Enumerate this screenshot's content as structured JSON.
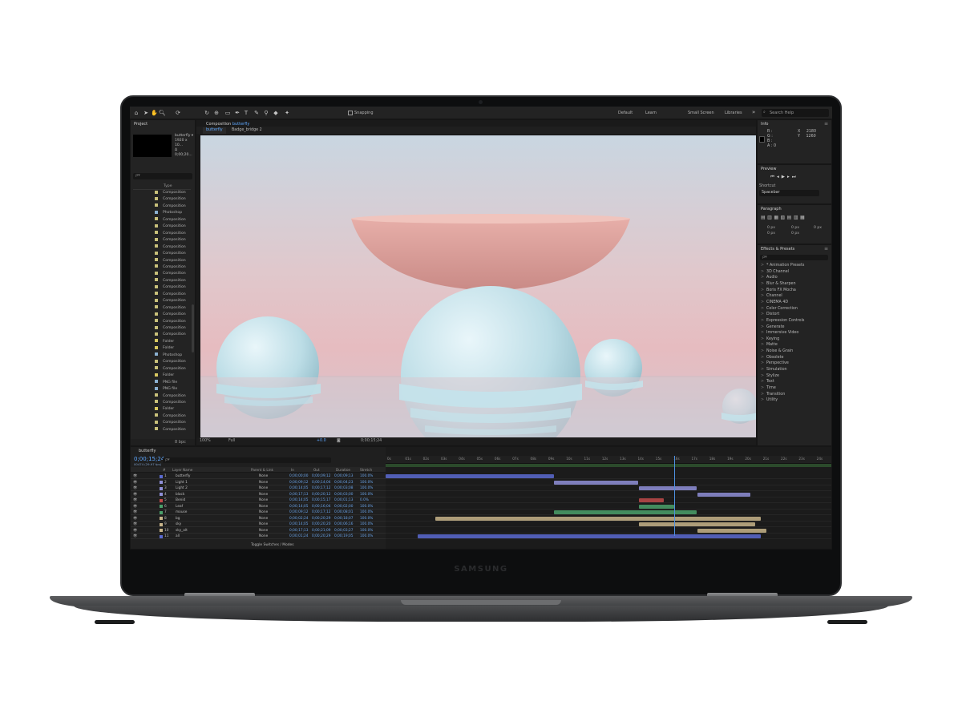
{
  "device": {
    "brand": "SAMSUNG"
  },
  "toolbar": {
    "snapping_label": "Snapping",
    "workspaces": [
      "Default",
      "Learn",
      "Small Screen",
      "Libraries"
    ],
    "search_placeholder": "Search Help",
    "more": "»"
  },
  "project_panel": {
    "title": "Project",
    "comp_name": "butterfly ▾",
    "comp_info_1": "1920 x 10...",
    "comp_info_2": "Δ 0;00;20...",
    "search_placeholder": "ρ▾",
    "column_type": "Type",
    "items": [
      "Composition",
      "Composition",
      "Composition",
      "Photoshop",
      "Composition",
      "Composition",
      "Composition",
      "Composition",
      "Composition",
      "Composition",
      "Composition",
      "Composition",
      "Composition",
      "Composition",
      "Composition",
      "Composition",
      "Composition",
      "Composition",
      "Composition",
      "Composition",
      "Composition",
      "Composition",
      "Folder",
      "Folder",
      "Photoshop",
      "Composition",
      "Composition",
      "Folder",
      "PNG file",
      "PNG file",
      "Composition",
      "Composition",
      "Folder",
      "Composition",
      "Composition",
      "Composition"
    ],
    "footer_bpc": "8 bpc"
  },
  "composition_panel": {
    "title": "Composition",
    "comp_name": "butterfly",
    "tabs": [
      "butterfly",
      "Badge_bridge 2"
    ],
    "zoom": "100%",
    "resolution": "Full",
    "exposure": "+0.0",
    "timecode": "0;00;15;24"
  },
  "info_panel": {
    "title": "Info",
    "x_label": "X",
    "x_value": "2180",
    "y_label": "Y",
    "y_value": "1260",
    "r": "R :",
    "g": "G :",
    "b": "B :",
    "a": "A : 0"
  },
  "preview_panel": {
    "title": "Preview",
    "shortcut_label": "Shortcut",
    "shortcut_value": "Spacebar"
  },
  "paragraph_panel": {
    "title": "Paragraph",
    "fields": [
      "0 px",
      "0 px",
      "0 px",
      "0 px",
      "0 px"
    ]
  },
  "effects_panel": {
    "title": "Effects & Presets",
    "search_placeholder": "ρ▾",
    "categories": [
      "* Animation Presets",
      "3D Channel",
      "Audio",
      "Blur & Sharpen",
      "Boris FX Mocha",
      "Channel",
      "CINEMA 4D",
      "Color Correction",
      "Distort",
      "Expression Controls",
      "Generate",
      "Immersive Video",
      "Keying",
      "Matte",
      "Noise & Grain",
      "Obsolete",
      "Perspective",
      "Simulation",
      "Stylize",
      "Text",
      "Time",
      "Transition",
      "Utility"
    ]
  },
  "timeline": {
    "tab": "butterfly",
    "timecode": "0;00;15;24",
    "fps": "00474 (29.97 fps)",
    "search_placeholder": "ρ▾",
    "columns": [
      "#",
      "Layer Name",
      "Parent & Link",
      "In",
      "Out",
      "Duration",
      "Stretch"
    ],
    "layers": [
      {
        "num": "1",
        "name": "butterfly",
        "parent": "None",
        "in": "0;00;00;00",
        "out": "0;00;09;12",
        "dur": "0;00;09;13",
        "stretch": "100.0%",
        "color": "#5b6ad0"
      },
      {
        "num": "2",
        "name": "Light 1",
        "parent": "None",
        "in": "0;00;09;12",
        "out": "0;00;14;04",
        "dur": "0;00;04;23",
        "stretch": "100.0%",
        "color": "#8f8fd8"
      },
      {
        "num": "3",
        "name": "Light 2",
        "parent": "None",
        "in": "0;00;14;05",
        "out": "0;00;17;12",
        "dur": "0;00;03;08",
        "stretch": "100.0%",
        "color": "#8f8fd8"
      },
      {
        "num": "4",
        "name": "black",
        "parent": "None",
        "in": "0;00;17;13",
        "out": "0;00;20;12",
        "dur": "0;00;03;00",
        "stretch": "100.0%",
        "color": "#8f8fd8"
      },
      {
        "num": "5",
        "name": "Benid",
        "parent": "None",
        "in": "0;00;14;05",
        "out": "0;00;15;17",
        "dur": "0;00;01;13",
        "stretch": "0.0%",
        "color": "#c04a4a"
      },
      {
        "num": "6",
        "name": "Leaf",
        "parent": "None",
        "in": "0;00;14;05",
        "out": "0;00;16;04",
        "dur": "0;00;02;00",
        "stretch": "100.0%",
        "color": "#4aa06a"
      },
      {
        "num": "7",
        "name": "mouse",
        "parent": "None",
        "in": "0;00;09;12",
        "out": "0;00;17;12",
        "dur": "0;00;08;01",
        "stretch": "100.0%",
        "color": "#4aa06a"
      },
      {
        "num": "8",
        "name": "bg",
        "parent": "None",
        "in": "0;00;02;24",
        "out": "0;00;20;29",
        "dur": "0;00;18;07",
        "stretch": "100.0%",
        "color": "#c7b48a"
      },
      {
        "num": "9",
        "name": "sky",
        "parent": "None",
        "in": "0;00;14;05",
        "out": "0;00;20;20",
        "dur": "0;00;06;16",
        "stretch": "100.0%",
        "color": "#c7b48a"
      },
      {
        "num": "10",
        "name": "sky_alt",
        "parent": "None",
        "in": "0;00;17;13",
        "out": "0;00;21;09",
        "dur": "0;00;03;27",
        "stretch": "100.0%",
        "color": "#c7b48a"
      },
      {
        "num": "11",
        "name": "all",
        "parent": "None",
        "in": "0;00;01;24",
        "out": "0;00;20;29",
        "dur": "0;00;19;05",
        "stretch": "100.0%",
        "color": "#5b6ad0"
      }
    ],
    "ruler_ticks": [
      "0s",
      "01s",
      "02s",
      "03s",
      "04s",
      "05s",
      "06s",
      "07s",
      "08s",
      "09s",
      "10s",
      "11s",
      "12s",
      "13s",
      "14s",
      "15s",
      "16s",
      "17s",
      "18s",
      "19s",
      "20s",
      "21s",
      "22s",
      "23s",
      "24s"
    ],
    "toggle_label": "Toggle Switches / Modes"
  }
}
